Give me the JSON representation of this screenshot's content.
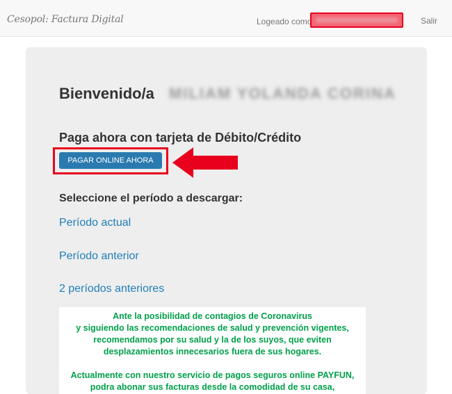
{
  "navbar": {
    "brand": "Cesopol: Factura Digital",
    "logged_label": "Logeado como",
    "logged_user": "",
    "logout_label": "Salir"
  },
  "main": {
    "welcome_label": "Bienvenido/a",
    "welcome_name": "MILIAM YOLANDA CORINA",
    "pay_heading": "Paga ahora con tarjeta de Débito/Crédito",
    "pay_button_label": "PAGAR ONLINE AHORA",
    "period_heading": "Seleccione el período a descargar:",
    "period_links": [
      "Período actual",
      "Período anterior",
      "2 períodos anteriores"
    ],
    "notice_lines": [
      "Ante la posibilidad de contagios de Coronavirus",
      "y siguiendo las recomendaciones de salud y prevención vigentes,",
      "recomendamos por su salud y la de los suyos, que eviten",
      "desplazamientos innecesarios fuera de sus hogares.",
      "Actualmente con nuestro servicio de pagos seguros online PAYFUN,",
      "podra abonar sus facturas desde la comodidad de su casa,"
    ]
  },
  "colors": {
    "highlight_red": "#e8001c",
    "button_blue": "#2a7ab0",
    "link_blue": "#1f7fb8",
    "notice_green": "#00a04a"
  }
}
